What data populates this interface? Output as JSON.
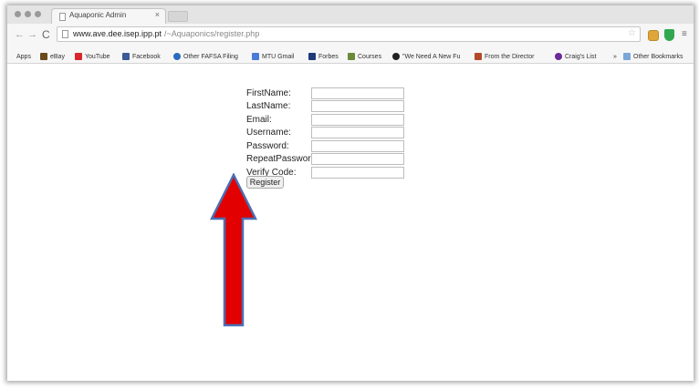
{
  "browser": {
    "tab": {
      "title": "Aquaponic Admin",
      "close": "×"
    },
    "toolbar": {
      "back": "←",
      "forward": "→",
      "reload": "C",
      "url_host": "www.ave.dee.isep.ipp.pt",
      "url_path": "/~Aquaponics/register.php",
      "star": "☆",
      "menu": "≡"
    },
    "bookmarks": [
      {
        "label": "Apps",
        "icon_color": ""
      },
      {
        "label": "eBay",
        "icon_color": "#6a4a1a"
      },
      {
        "label": "YouTube",
        "icon_color": "#d8262c"
      },
      {
        "label": "Facebook",
        "icon_color": "#3b5998"
      },
      {
        "label": "Other FAFSA Filing",
        "icon_color": "#2a6bbf"
      },
      {
        "label": "MTU Gmail",
        "icon_color": "#4a7bd8"
      },
      {
        "label": "Forbes",
        "icon_color": "#1e3a78"
      },
      {
        "label": "Courses",
        "icon_color": "#6a8a3a"
      },
      {
        "label": "\"We Need A New Fu",
        "icon_color": "#222222"
      },
      {
        "label": "From the Director",
        "icon_color": "#b24a2a"
      },
      {
        "label": "Craig's List",
        "icon_color": "#6a2a9a"
      },
      {
        "label": "»",
        "icon_color": ""
      },
      {
        "label": "Other Bookmarks",
        "icon_color": "#7aa6d8"
      }
    ]
  },
  "form": {
    "fields": [
      {
        "label": "FirstName:",
        "value": ""
      },
      {
        "label": "LastName:",
        "value": ""
      },
      {
        "label": "Email:",
        "value": ""
      },
      {
        "label": "Username:",
        "value": ""
      },
      {
        "label": "Password:",
        "value": ""
      },
      {
        "label": "RepeatPassword:",
        "value": ""
      },
      {
        "label": "Verify Code:",
        "value": ""
      }
    ],
    "submit_label": "Register"
  },
  "annotation": {
    "arrow_color": "#e30000",
    "arrow_outline": "#4a6fb4"
  }
}
